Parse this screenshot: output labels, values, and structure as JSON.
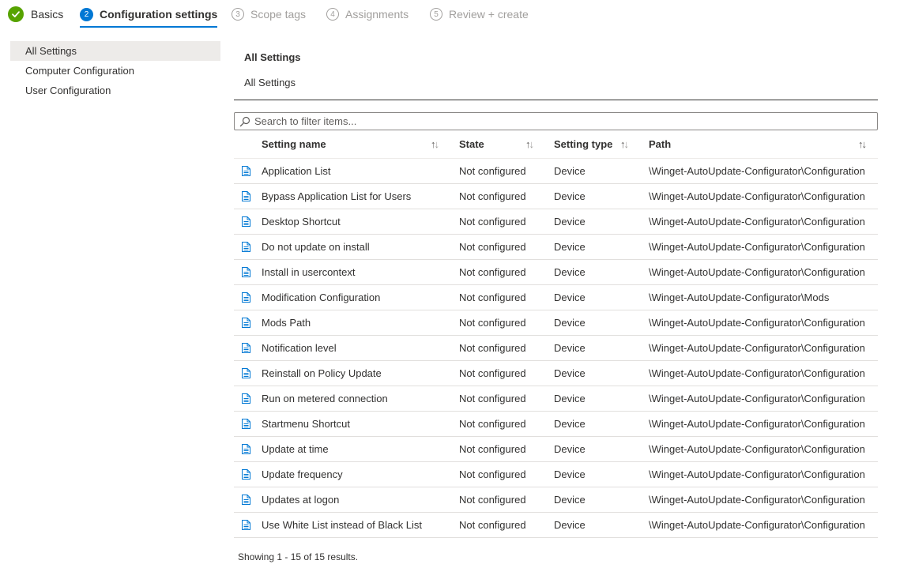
{
  "wizard": {
    "steps": [
      {
        "number": "",
        "label": "Basics",
        "status": "done"
      },
      {
        "number": "2",
        "label": "Configuration settings",
        "status": "active"
      },
      {
        "number": "3",
        "label": "Scope tags",
        "status": "pending"
      },
      {
        "number": "4",
        "label": "Assignments",
        "status": "pending"
      },
      {
        "number": "5",
        "label": "Review + create",
        "status": "pending"
      }
    ]
  },
  "sidebar": {
    "items": [
      {
        "label": "All Settings",
        "selected": true
      },
      {
        "label": "Computer Configuration",
        "selected": false
      },
      {
        "label": "User Configuration",
        "selected": false
      }
    ]
  },
  "main": {
    "title": "All Settings",
    "subtitle": "All Settings",
    "search": {
      "placeholder": "Search to filter items..."
    },
    "columns": [
      "Setting name",
      "State",
      "Setting type",
      "Path"
    ],
    "rows": [
      {
        "name": "Application List",
        "state": "Not configured",
        "type": "Device",
        "path": "\\Winget-AutoUpdate-Configurator\\Configuration"
      },
      {
        "name": "Bypass Application List for Users",
        "state": "Not configured",
        "type": "Device",
        "path": "\\Winget-AutoUpdate-Configurator\\Configuration"
      },
      {
        "name": "Desktop Shortcut",
        "state": "Not configured",
        "type": "Device",
        "path": "\\Winget-AutoUpdate-Configurator\\Configuration"
      },
      {
        "name": "Do not update on install",
        "state": "Not configured",
        "type": "Device",
        "path": "\\Winget-AutoUpdate-Configurator\\Configuration"
      },
      {
        "name": "Install in usercontext",
        "state": "Not configured",
        "type": "Device",
        "path": "\\Winget-AutoUpdate-Configurator\\Configuration"
      },
      {
        "name": "Modification Configuration",
        "state": "Not configured",
        "type": "Device",
        "path": "\\Winget-AutoUpdate-Configurator\\Mods"
      },
      {
        "name": "Mods Path",
        "state": "Not configured",
        "type": "Device",
        "path": "\\Winget-AutoUpdate-Configurator\\Configuration"
      },
      {
        "name": "Notification level",
        "state": "Not configured",
        "type": "Device",
        "path": "\\Winget-AutoUpdate-Configurator\\Configuration"
      },
      {
        "name": "Reinstall on Policy Update",
        "state": "Not configured",
        "type": "Device",
        "path": "\\Winget-AutoUpdate-Configurator\\Configuration"
      },
      {
        "name": "Run on metered connection",
        "state": "Not configured",
        "type": "Device",
        "path": "\\Winget-AutoUpdate-Configurator\\Configuration"
      },
      {
        "name": "Startmenu Shortcut",
        "state": "Not configured",
        "type": "Device",
        "path": "\\Winget-AutoUpdate-Configurator\\Configuration"
      },
      {
        "name": "Update at time",
        "state": "Not configured",
        "type": "Device",
        "path": "\\Winget-AutoUpdate-Configurator\\Configuration"
      },
      {
        "name": "Update frequency",
        "state": "Not configured",
        "type": "Device",
        "path": "\\Winget-AutoUpdate-Configurator\\Configuration"
      },
      {
        "name": "Updates at logon",
        "state": "Not configured",
        "type": "Device",
        "path": "\\Winget-AutoUpdate-Configurator\\Configuration"
      },
      {
        "name": "Use White List instead of Black List",
        "state": "Not configured",
        "type": "Device",
        "path": "\\Winget-AutoUpdate-Configurator\\Configuration"
      }
    ],
    "footer": "Showing 1 - 15 of 15 results."
  },
  "icons": {
    "done_step": "checkmark-icon",
    "search": "search-icon",
    "sort": "sort-icon",
    "row": "document-icon"
  },
  "colors": {
    "accent": "#0078d4",
    "success": "#57a300",
    "pending": "#a19f9d",
    "selected_bg": "#edebe9"
  }
}
